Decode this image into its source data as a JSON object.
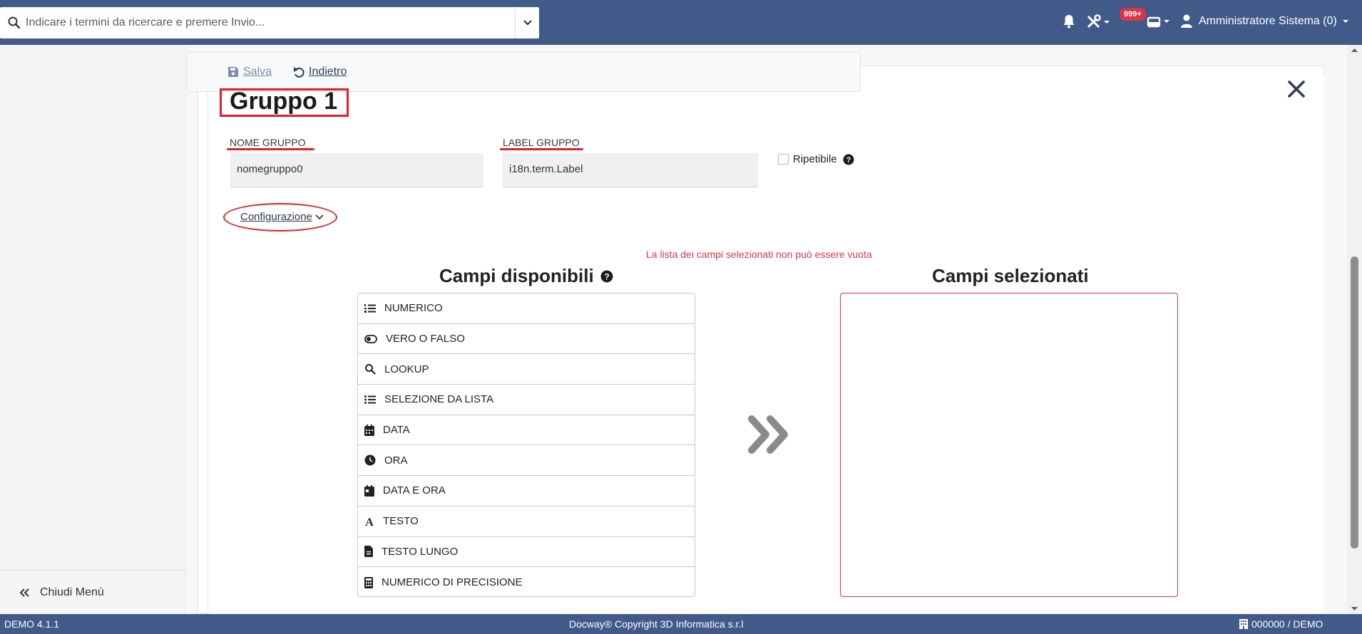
{
  "search": {
    "placeholder": "Indicare i termini da ricercare e premere Invio..."
  },
  "navbar": {
    "notification_badge": "999+",
    "user_label": "Amministratore Sistema (0)"
  },
  "sidebar": {
    "close_menu_label": "Chiudi Menù"
  },
  "toolbar": {
    "save_label": "Salva",
    "back_label": "Indietro"
  },
  "form": {
    "title": "Gruppo 1",
    "group_name_label": "NOME GRUPPO",
    "group_name_value": "nomegruppo0",
    "group_label_label": "LABEL GRUPPO",
    "group_label_value": "i18n.term.Label",
    "repeatable_label": "Ripetibile",
    "config_link": "Configurazione",
    "error_message": "La lista dei campi selezionati non può essere vuota"
  },
  "available": {
    "title": "Campi disponibili",
    "items": [
      {
        "label": "NUMERICO",
        "icon": "list-ol-icon"
      },
      {
        "label": "VERO O FALSO",
        "icon": "toggle-icon"
      },
      {
        "label": "LOOKUP",
        "icon": "search-icon"
      },
      {
        "label": "SELEZIONE DA LISTA",
        "icon": "list-icon"
      },
      {
        "label": "DATA",
        "icon": "calendar-icon"
      },
      {
        "label": "ORA",
        "icon": "clock-icon"
      },
      {
        "label": "DATA E ORA",
        "icon": "calendar-day-icon"
      },
      {
        "label": "TESTO",
        "icon": "font-icon"
      },
      {
        "label": "TESTO LUNGO",
        "icon": "file-text-icon"
      },
      {
        "label": "NUMERICO DI PRECISIONE",
        "icon": "calculator-icon"
      }
    ]
  },
  "selected": {
    "title": "Campi selezionati"
  },
  "footer": {
    "version": "DEMO 4.1.1",
    "copyright": "Docway® Copyright 3D Informatica s.r.l",
    "office": "000000 / DEMO"
  },
  "colors": {
    "navbar": "#415a8a",
    "error": "#dc3545",
    "annotation": "#e31e24"
  }
}
